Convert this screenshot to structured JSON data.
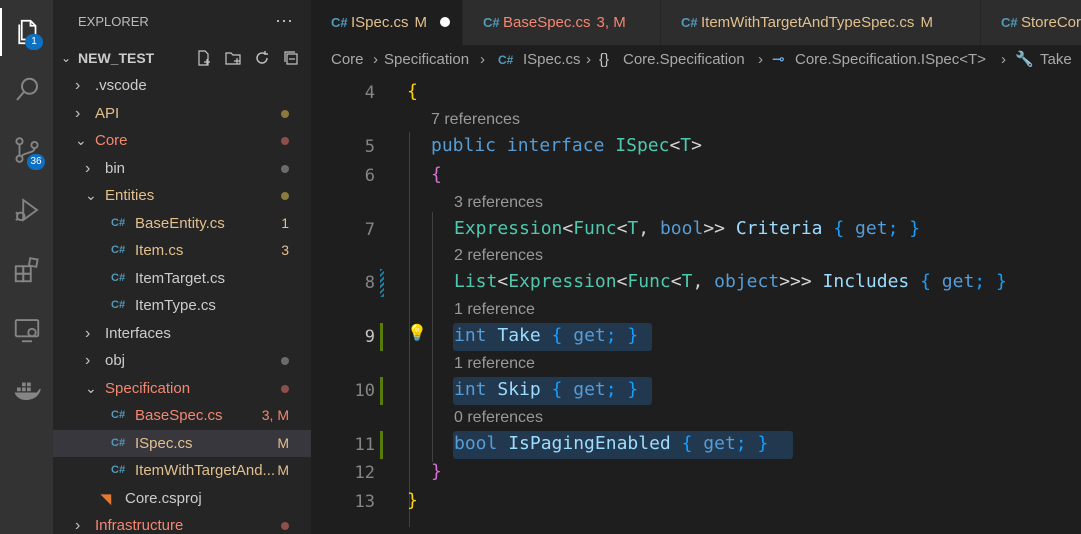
{
  "activity_bar": {
    "explorer_badge": "1",
    "source_control_badge": "36",
    "icons": [
      "explorer-icon",
      "search-icon",
      "source-control-icon",
      "run-debug-icon",
      "extensions-icon",
      "remote-explorer-icon",
      "docker-icon"
    ]
  },
  "sidebar": {
    "title": "EXPLORER",
    "more": "···",
    "section": "NEW_TEST",
    "tree": [
      {
        "label": ".vscode",
        "kind": "folder",
        "expanded": false,
        "status": "",
        "color": "#cccccc",
        "dot": ""
      },
      {
        "label": "API",
        "kind": "folder",
        "expanded": false,
        "status": "",
        "color": "#e2c08d",
        "dot": "#8c7a3c"
      },
      {
        "label": "Core",
        "kind": "folder",
        "expanded": true,
        "status": "",
        "color": "#f48771",
        "dot": "#8c4f4a"
      },
      {
        "label": "bin",
        "kind": "folder",
        "expanded": false,
        "status": "",
        "color": "#cccccc",
        "dot": "#6b6b6b"
      },
      {
        "label": "Entities",
        "kind": "folder",
        "expanded": true,
        "status": "",
        "color": "#e2c08d",
        "dot": "#8c7a3c"
      },
      {
        "label": "BaseEntity.cs",
        "kind": "cs",
        "status": "1",
        "color": "#e2c08d",
        "dot": ""
      },
      {
        "label": "Item.cs",
        "kind": "cs",
        "status": "3",
        "color": "#e2c08d",
        "dot": ""
      },
      {
        "label": "ItemTarget.cs",
        "kind": "cs",
        "status": "",
        "color": "#cccccc",
        "dot": ""
      },
      {
        "label": "ItemType.cs",
        "kind": "cs",
        "status": "",
        "color": "#cccccc",
        "dot": ""
      },
      {
        "label": "Interfaces",
        "kind": "folder",
        "expanded": false,
        "status": "",
        "color": "#cccccc",
        "dot": ""
      },
      {
        "label": "obj",
        "kind": "folder",
        "expanded": false,
        "status": "",
        "color": "#cccccc",
        "dot": "#6b6b6b"
      },
      {
        "label": "Specification",
        "kind": "folder",
        "expanded": true,
        "status": "",
        "color": "#f48771",
        "dot": "#8c4f4a"
      },
      {
        "label": "BaseSpec.cs",
        "kind": "cs",
        "status": "3, M",
        "color": "#f48771",
        "dot": ""
      },
      {
        "label": "ISpec.cs",
        "kind": "cs",
        "status": "M",
        "color": "#e2c08d",
        "dot": ""
      },
      {
        "label": "ItemWithTargetAnd...",
        "kind": "cs",
        "status": "M",
        "color": "#e2c08d",
        "dot": ""
      },
      {
        "label": "Core.csproj",
        "kind": "rss",
        "status": "",
        "color": "#cccccc",
        "dot": ""
      },
      {
        "label": "Infrastructure",
        "kind": "folder",
        "expanded": false,
        "status": "",
        "color": "#f48771",
        "dot": "#8c4f4a"
      }
    ]
  },
  "tabs": [
    {
      "label": "ISpec.cs",
      "status": "M",
      "dirty": true,
      "color": "#e2c08d"
    },
    {
      "label": "BaseSpec.cs",
      "status": "3, M",
      "dirty": false,
      "color": "#f48771"
    },
    {
      "label": "ItemWithTargetAndTypeSpec.cs",
      "status": "M",
      "dirty": false,
      "color": "#e2c08d"
    },
    {
      "label": "StoreCor",
      "status": "",
      "dirty": false,
      "color": "#e2c08d"
    }
  ],
  "breadcrumb": [
    "Core",
    "Specification",
    "ISpec.cs",
    "Core.Specification",
    "Core.Specification.ISpec<T>",
    "Take"
  ],
  "editor": {
    "line_numbers": [
      "4",
      "5",
      "6",
      "7",
      "8",
      "9",
      "10",
      "11",
      "12",
      "13"
    ],
    "codelens": [
      "7 references",
      "3 references",
      "2 references",
      "1 reference",
      "1 reference",
      "0 references"
    ],
    "code": {
      "l4": "{",
      "l5_kw1": "public",
      "l5_kw2": "interface",
      "l5_name": "ISpec",
      "l5_lt": "<",
      "l5_t": "T",
      "l5_gt": ">",
      "l6": "{",
      "l7_type": "Expression",
      "l7_a": "<",
      "l7_func": "Func",
      "l7_b": "<",
      "l7_t": "T",
      "l7_c": ", ",
      "l7_bool": "bool",
      "l7_d": ">> ",
      "l7_prop": "Criteria",
      "l7_e": " { ",
      "l7_get": "get",
      "l7_f": "; }",
      "l8_type": "List",
      "l8_a": "<",
      "l8_expr": "Expression",
      "l8_b": "<",
      "l8_func": "Func",
      "l8_c": "<",
      "l8_t": "T",
      "l8_d": ", ",
      "l8_obj": "object",
      "l8_e": ">>> ",
      "l8_prop": "Includes",
      "l8_f": " { ",
      "l8_get": "get",
      "l8_g": "; }",
      "l9_kw": "int",
      "l9_prop": "Take",
      "l9_a": " { ",
      "l9_get": "get",
      "l9_b": "; }",
      "l10_kw": "int",
      "l10_prop": "Skip",
      "l10_a": " { ",
      "l10_get": "get",
      "l10_b": "; }",
      "l11_kw": "bool",
      "l11_prop": "IsPagingEnabled",
      "l11_a": " { ",
      "l11_get": "get",
      "l11_b": "; }",
      "l12": "}",
      "l13": "}"
    }
  }
}
